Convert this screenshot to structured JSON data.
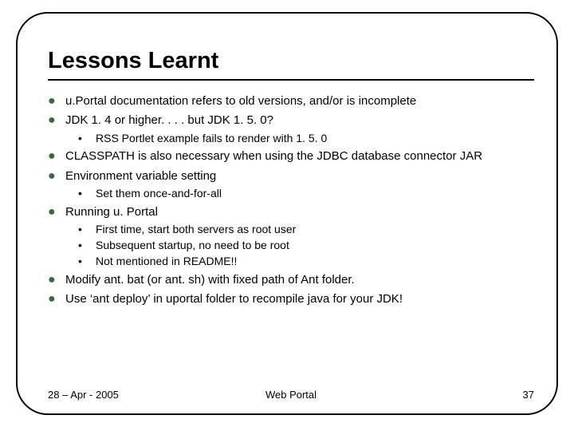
{
  "title": "Lessons Learnt",
  "b1": "u.Portal documentation refers to old versions, and/or is incomplete",
  "b2": "JDK 1. 4 or higher. . . . but JDK 1. 5. 0?",
  "b2s1": "RSS Portlet example fails to render with 1. 5. 0",
  "b3": "CLASSPATH is also necessary when using the JDBC database connector JAR",
  "b4": "Environment variable setting",
  "b4s1": "Set them once-and-for-all",
  "b5": "Running u. Portal",
  "b5s1": "First time, start both servers as root user",
  "b5s2": "Subsequent startup, no need to be root",
  "b5s3": "Not mentioned in README!!",
  "b6": "Modify ant. bat (or ant. sh) with fixed path of Ant folder.",
  "b7": "Use ‘ant deploy’ in uportal folder to recompile java for your JDK!",
  "footer": {
    "date": "28 – Apr - 2005",
    "center": "Web Portal",
    "page": "37"
  }
}
